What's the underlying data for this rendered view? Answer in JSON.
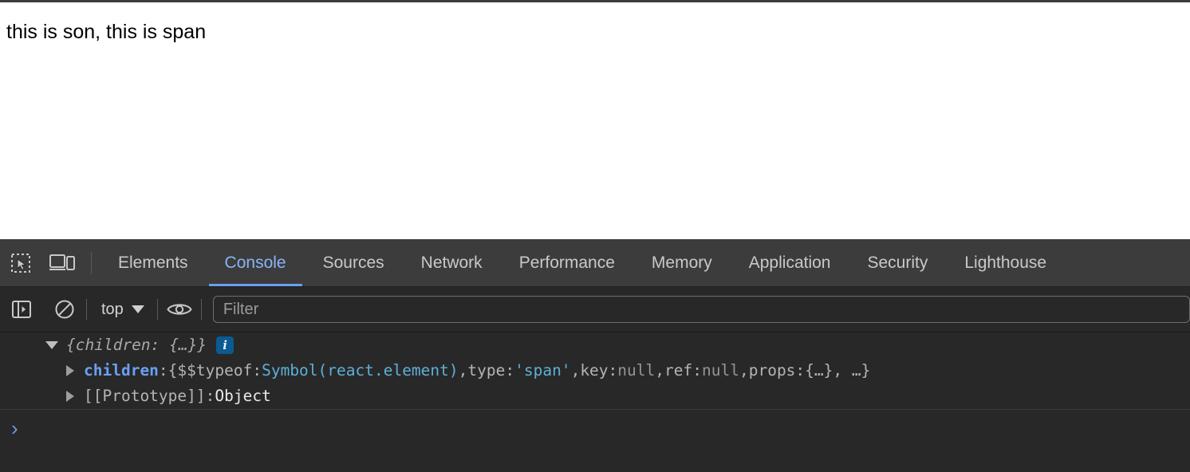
{
  "page": {
    "content_text": "this is son, this is span"
  },
  "devtools": {
    "toolbar_icons": [
      {
        "name": "inspect-element-icon",
        "title": "Inspect element"
      },
      {
        "name": "device-toolbar-icon",
        "title": "Toggle device toolbar"
      }
    ],
    "tabs": [
      {
        "label": "Elements",
        "active": false
      },
      {
        "label": "Console",
        "active": true
      },
      {
        "label": "Sources",
        "active": false
      },
      {
        "label": "Network",
        "active": false
      },
      {
        "label": "Performance",
        "active": false
      },
      {
        "label": "Memory",
        "active": false
      },
      {
        "label": "Application",
        "active": false
      },
      {
        "label": "Security",
        "active": false
      },
      {
        "label": "Lighthouse",
        "active": false
      }
    ],
    "active_tab_color": "#8ab4f8",
    "console_toolbar": {
      "sidebar_toggle_icon": "sidebar-toggle-icon",
      "clear_console_icon": "clear-console-icon",
      "context_selector": "top",
      "eye_icon": "live-expression-eye-icon",
      "filter_placeholder": "Filter",
      "filter_value": ""
    },
    "console_output": {
      "line1": {
        "expander": "expanded",
        "text": "{children: {…}}",
        "badge": "i"
      },
      "line2": {
        "expander": "collapsed",
        "key": "children",
        "open_brace": "{",
        "typeof_key": "$$typeof",
        "colon1": ": ",
        "symbol_value": "Symbol(react.element)",
        "comma1": ", ",
        "type_key": "type",
        "colon2": ": ",
        "type_value": "'span'",
        "comma2": ", ",
        "key_key": "key",
        "colon3": ": ",
        "key_value": "null",
        "comma3": ", ",
        "ref_key": "ref",
        "colon4": ": ",
        "ref_value": "null",
        "comma4": ", ",
        "props_key": "props",
        "colon5": ": ",
        "props_value": "{…}",
        "tail": ", …}",
        "key_colon": ": "
      },
      "line3": {
        "expander": "collapsed",
        "label": "[[Prototype]]",
        "colon": ": ",
        "value": "Object"
      }
    },
    "prompt": {
      "chevron": "›"
    }
  }
}
